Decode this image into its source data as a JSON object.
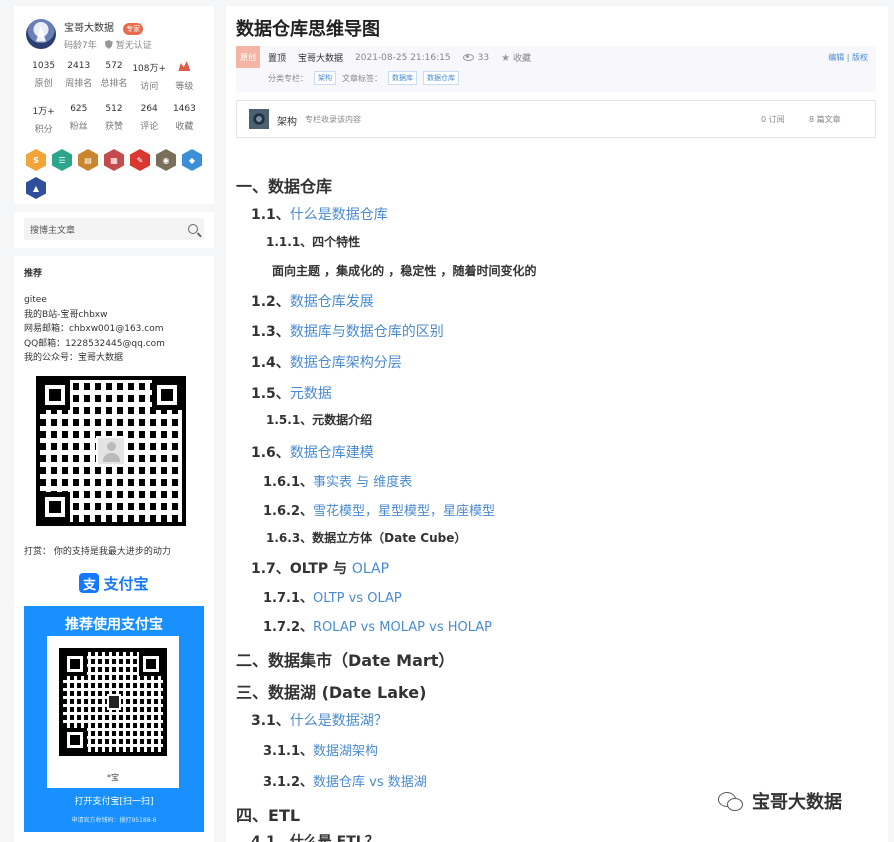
{
  "profile": {
    "name": "宝哥大数据",
    "badge": "专家",
    "age": "码龄7年",
    "cert": "暂无认证",
    "stats_row1": [
      {
        "value": "1035",
        "label": "原创"
      },
      {
        "value": "2413",
        "label": "周排名"
      },
      {
        "value": "572",
        "label": "总排名"
      },
      {
        "value": "108万+",
        "label": "访问"
      },
      {
        "value": "",
        "label": "等级"
      }
    ],
    "stats_row2": [
      {
        "value": "1万+",
        "label": "积分"
      },
      {
        "value": "625",
        "label": "粉丝"
      },
      {
        "value": "512",
        "label": "获赞"
      },
      {
        "value": "264",
        "label": "评论"
      },
      {
        "value": "1463",
        "label": "收藏"
      }
    ],
    "medals": [
      {
        "icon": "s-medal-icon",
        "glyph": "S",
        "color": "#f2a33a"
      },
      {
        "icon": "list-medal-icon",
        "glyph": "☰",
        "color": "#2ba58c"
      },
      {
        "icon": "book-medal-icon",
        "glyph": "▤",
        "color": "#c9862f"
      },
      {
        "icon": "calendar-medal-icon",
        "glyph": "▦",
        "color": "#c44b4b"
      },
      {
        "icon": "pen-medal-icon",
        "glyph": "✎",
        "color": "#d9372f"
      },
      {
        "icon": "years-medal-icon",
        "glyph": "◉",
        "color": "#7a6f5a"
      },
      {
        "icon": "diamond-medal-icon",
        "glyph": "◆",
        "color": "#3b8fd8"
      },
      {
        "icon": "rocket-medal-icon",
        "glyph": "▲",
        "color": "#2f4f9a"
      }
    ]
  },
  "search": {
    "placeholder": "搜博主文章"
  },
  "recommend": {
    "title": "推荐",
    "lines": [
      "gitee",
      "我的B站-宝哥chbxw",
      "网易邮箱：chbxw001@163.com",
      "QQ邮箱：1228532445@qq.com",
      "我的公众号：宝哥大数据"
    ],
    "reward": "打赏：  你的支持是我最大进步的动力",
    "alipay_logo": "支付宝",
    "alipay_card": {
      "title": "推荐使用支付宝",
      "name": "*宝",
      "button": "打开支付宝[扫一扫]",
      "footer": "申请官方收钱码：拨打95188-6"
    }
  },
  "article": {
    "title": "数据仓库思维导图",
    "original": "原创",
    "top": "置顶",
    "author": "宝哥大数据",
    "date": "2021-08-25 21:16:15",
    "views": "33",
    "favorite": "收藏",
    "edit": "编辑",
    "copyright": "版权",
    "column_label": "分类专栏：",
    "column_tag": "架构",
    "tags_label": "文章标签：",
    "tags": [
      "数据库",
      "数据仓库"
    ]
  },
  "column_box": {
    "name": "架构",
    "desc": "专栏收录该内容",
    "subscriptions": "0 订阅",
    "articles": "8 篇文章"
  },
  "toc": [
    {
      "cls": "h1",
      "num": "一、",
      "text": "数据仓库",
      "link": false
    },
    {
      "cls": "h2",
      "num": "1.1、",
      "text": "什么是数据仓库",
      "link": true
    },
    {
      "cls": "h3",
      "num": "1.1.1、",
      "text": "四个特性",
      "link": false
    },
    {
      "cls": "h3",
      "num": "",
      "text": "面向主题 ，集成化的 ，稳定性 ，随着时间变化的",
      "link": false
    },
    {
      "cls": "h2",
      "num": "1.2、",
      "text": "数据仓库发展",
      "link": true
    },
    {
      "cls": "h2",
      "num": "1.3、",
      "text": "数据库与数据仓库的区别",
      "link": true
    },
    {
      "cls": "h2",
      "num": "1.4、",
      "text": "数据仓库架构分层",
      "link": true
    },
    {
      "cls": "h2",
      "num": "1.5、",
      "text": "元数据",
      "link": true
    },
    {
      "cls": "h3",
      "num": "1.5.1、",
      "text": "元数据介绍",
      "link": false
    },
    {
      "cls": "h2",
      "num": "1.6、",
      "text": "数据仓库建模",
      "link": true
    },
    {
      "cls": "h3n",
      "num": "1.6.1、",
      "text": "事实表 与 维度表",
      "link": true
    },
    {
      "cls": "h3n",
      "num": "1.6.2、",
      "text": "雪花模型，星型模型，星座模型",
      "link": true
    },
    {
      "cls": "h3",
      "num": "1.6.3、",
      "text": "数据立方体（Date Cube）",
      "link": false
    },
    {
      "cls": "h2",
      "num": "1.7、",
      "text": "OLTP 与 ",
      "link": false,
      "tail": "OLAP"
    },
    {
      "cls": "h3n",
      "num": "1.7.1、",
      "text": "OLTP vs OLAP",
      "link": true
    },
    {
      "cls": "h3n",
      "num": "1.7.2、",
      "text": "ROLAP vs MOLAP vs HOLAP",
      "link": true
    },
    {
      "cls": "h1",
      "num": "二、",
      "text": "数据集市（Date Mart）",
      "link": false
    },
    {
      "cls": "h1",
      "num": "三、",
      "text": "数据湖 (Date Lake)",
      "link": false
    },
    {
      "cls": "h2",
      "num": "3.1、",
      "text": "什么是数据湖？",
      "link": true
    },
    {
      "cls": "h3n",
      "num": "3.1.1、",
      "text": "数据湖架构",
      "link": true
    },
    {
      "cls": "h3n",
      "num": "3.1.2、",
      "text": "数据仓库 vs 数据湖",
      "link": true
    },
    {
      "cls": "h1",
      "num": "四、",
      "text": "ETL",
      "link": false
    },
    {
      "cls": "h2",
      "num": "4.1、",
      "text": "什么是 ETL？",
      "link": false
    }
  ],
  "watermark": {
    "text": "宝哥大数据",
    "icon": "wechat-icon"
  }
}
